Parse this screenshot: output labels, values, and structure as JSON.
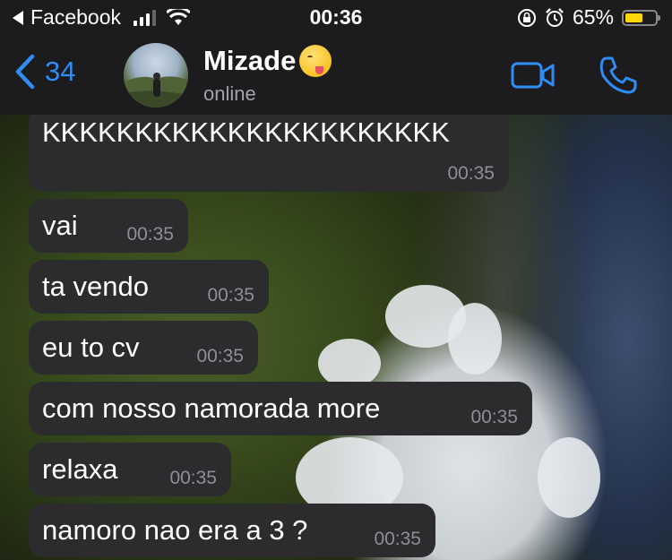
{
  "status_bar": {
    "back_app": "Facebook",
    "time": "00:36",
    "battery": "65%",
    "battery_level": 0.65,
    "icons": [
      "back-arrow-icon",
      "signal-icon",
      "wifi-icon",
      "orientation-lock-icon",
      "alarm-icon",
      "battery-icon"
    ]
  },
  "header": {
    "back_count": "34",
    "contact_name": "Mizade",
    "name_emoji": "drooling-face-emoji",
    "status": "online",
    "actions": [
      "video-call-icon",
      "phone-icon"
    ],
    "accent_color": "#2f8cf5"
  },
  "messages": [
    {
      "text": "KKKKKKKKKKKKKKKKKKKKKK",
      "time": "00:35"
    },
    {
      "text": "vai",
      "time": "00:35"
    },
    {
      "text": "ta vendo",
      "time": "00:35"
    },
    {
      "text": "eu to cv",
      "time": "00:35"
    },
    {
      "text": "com nosso namorada more",
      "time": "00:35"
    },
    {
      "text": "relaxa",
      "time": "00:35"
    },
    {
      "text": "namoro nao era a 3 ?",
      "time": "00:35"
    }
  ],
  "colors": {
    "bubble": "#2c2c2e",
    "timestamp": "#8e8e93",
    "header_bg": "#1c1c1e",
    "battery_fill": "#ffd60a"
  }
}
